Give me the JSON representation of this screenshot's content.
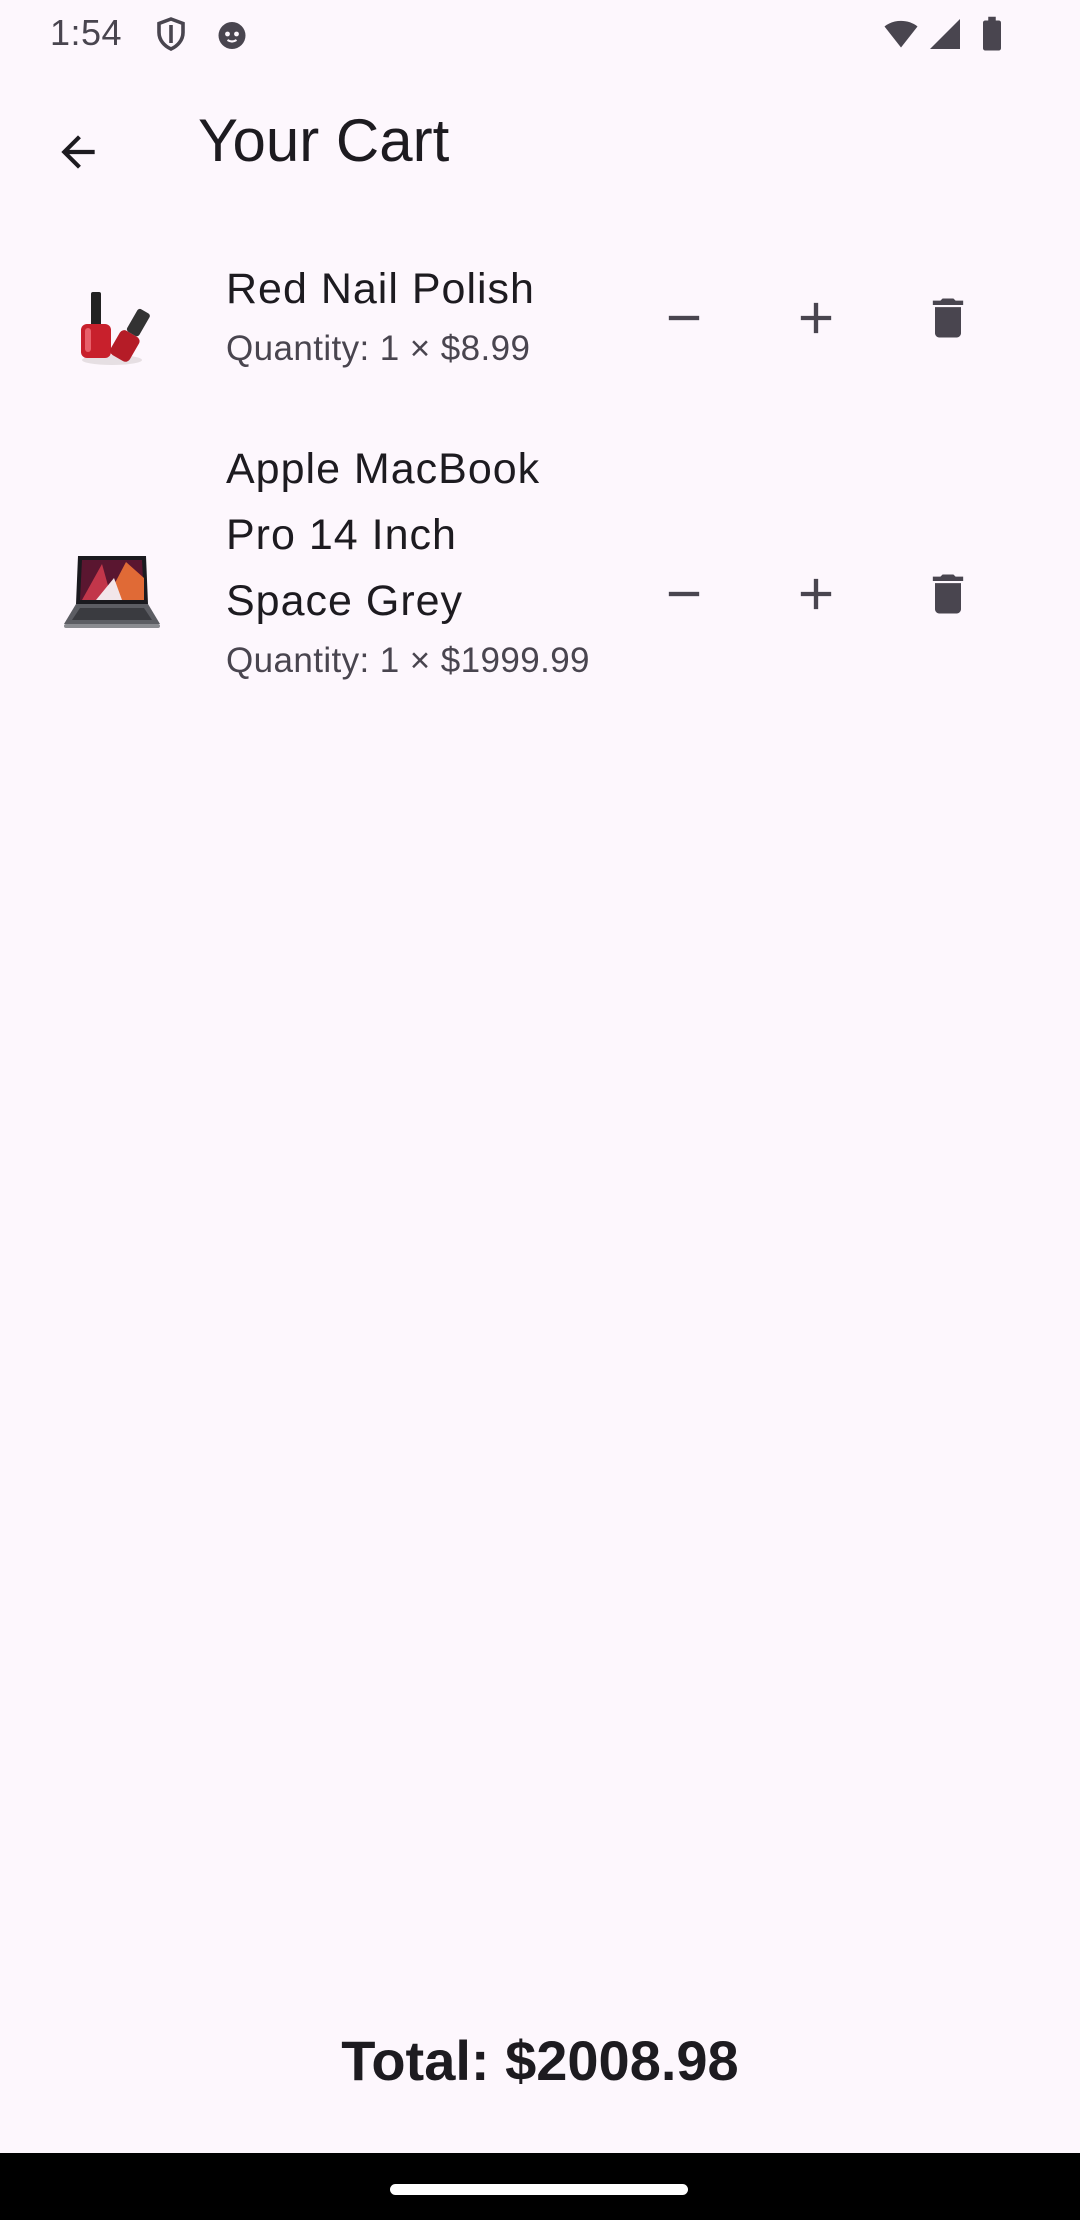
{
  "status_bar": {
    "time": "1:54",
    "icons": [
      "shield-icon",
      "cat-face-icon",
      "wifi-icon",
      "signal-icon",
      "battery-icon"
    ]
  },
  "app_bar": {
    "title": "Your Cart",
    "back_icon": "arrow-back-icon"
  },
  "cart": {
    "items": [
      {
        "name": "Red Nail Polish",
        "quantity_line": "Quantity: 1 × $8.99",
        "thumbnail": "nail-polish-image"
      },
      {
        "name": "Apple MacBook Pro 14 Inch Space Grey",
        "quantity_line": "Quantity: 1 × $1999.99",
        "thumbnail": "laptop-image"
      }
    ],
    "actions": {
      "decrease_icon": "minus-icon",
      "increase_icon": "plus-icon",
      "delete_icon": "trash-icon"
    }
  },
  "total": {
    "label": "Total: $2008.98"
  },
  "colors": {
    "background": "#fdf7fd",
    "text_primary": "#1d1b20",
    "text_secondary": "#49454f",
    "icon": "#49454f"
  }
}
